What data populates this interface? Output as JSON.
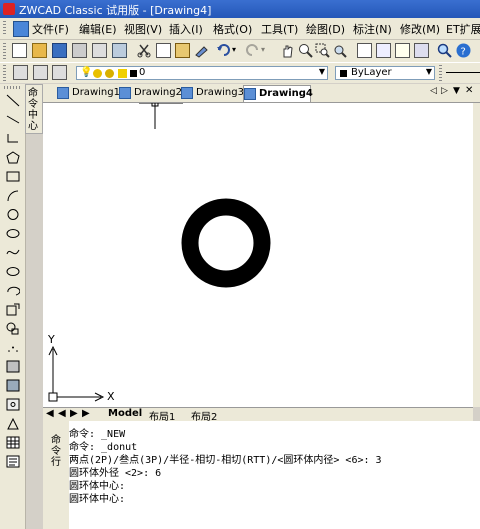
{
  "window": {
    "title": "ZWCAD Classic 试用版 - [Drawing4]"
  },
  "menu": [
    {
      "id": "file",
      "label": "文件(F)"
    },
    {
      "id": "edit",
      "label": "编辑(E)"
    },
    {
      "id": "view",
      "label": "视图(V)"
    },
    {
      "id": "insert",
      "label": "插入(I)"
    },
    {
      "id": "format",
      "label": "格式(O)"
    },
    {
      "id": "tools",
      "label": "工具(T)"
    },
    {
      "id": "draw",
      "label": "绘图(D)"
    },
    {
      "id": "dimension",
      "label": "标注(N)"
    },
    {
      "id": "modify",
      "label": "修改(M)"
    },
    {
      "id": "et",
      "label": "ET扩展"
    }
  ],
  "layers": {
    "current_layer": "0",
    "color_value": "ByLayer"
  },
  "side_panel": {
    "label": "命令中心"
  },
  "doc_tabs": [
    {
      "label": "Drawing1",
      "active": false
    },
    {
      "label": "Drawing2",
      "active": false
    },
    {
      "label": "Drawing3",
      "active": false
    },
    {
      "label": "Drawing4",
      "active": true
    }
  ],
  "ucs": {
    "y_label": "Y",
    "x_label": "X"
  },
  "layout_tabs": {
    "model": "Model",
    "layout1": "布局1",
    "layout2": "布局2"
  },
  "command_panel": {
    "label": "命令行"
  },
  "command_lines": [
    "命令: _NEW",
    "命令: _donut",
    "两点(2P)/叁点(3P)/半径-相切-相切(RTT)/<圆环体内径> <6>: 3",
    "圆环体外径 <2>: 6",
    "圆环体中心:",
    "圆环体中心:"
  ],
  "colors": {
    "title_bar": "#2457b8",
    "toolbar_bg": "#ece9d8",
    "canvas_bg": "#ffffff",
    "donut": "#000000"
  }
}
